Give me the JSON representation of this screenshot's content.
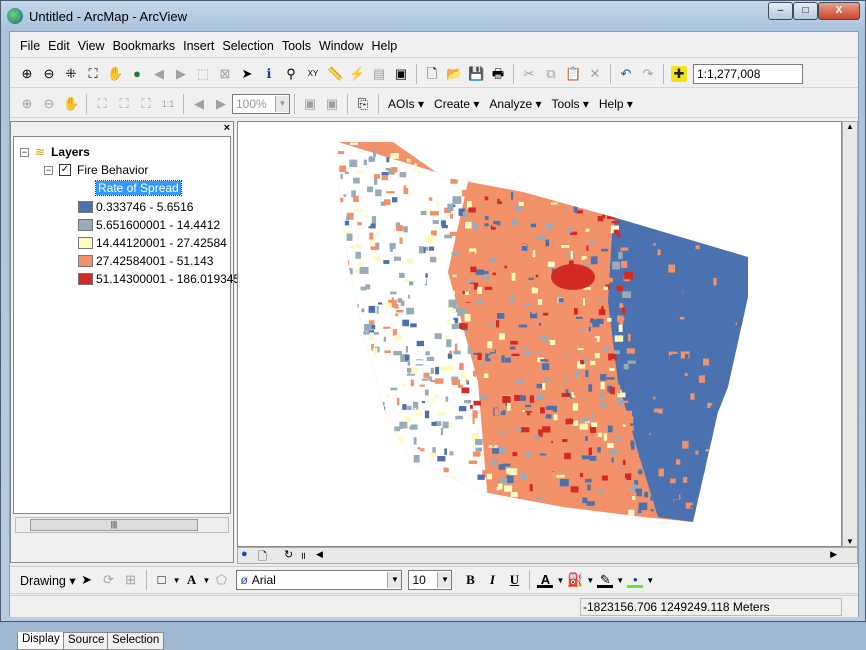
{
  "window": {
    "title": "Untitled - ArcMap - ArcView",
    "minimize": "–",
    "maximize": "□",
    "close": "X"
  },
  "menu": [
    "File",
    "Edit",
    "View",
    "Bookmarks",
    "Insert",
    "Selection",
    "Tools",
    "Window",
    "Help"
  ],
  "toolbar": {
    "scale": "1:1,277,008",
    "zoom_percent": "100%"
  },
  "extension_menu": [
    "AOIs",
    "Create",
    "Analyze",
    "Tools",
    "Help"
  ],
  "toc": {
    "root": "Layers",
    "layer": "Fire Behavior",
    "layer_checked": true,
    "field": "Rate of Spread",
    "legend": [
      {
        "label": "0.333746 - 5.6516",
        "color": "#4a72b0"
      },
      {
        "label": "5.651600001 - 14.4412",
        "color": "#9aabb8"
      },
      {
        "label": "14.44120001 - 27.42584",
        "color": "#fdfbc0"
      },
      {
        "label": "27.42584001 - 51.143",
        "color": "#f2916a"
      },
      {
        "label": "51.14300001 - 186.019345",
        "color": "#d42a26"
      }
    ],
    "tabs": [
      "Display",
      "Source",
      "Selection"
    ]
  },
  "drawing": {
    "label": "Drawing",
    "font": "Arial",
    "size": "10",
    "bold": "B",
    "italic": "I",
    "underline": "U"
  },
  "status": {
    "coordinates": "-1823156.706  1249249.118 Meters"
  }
}
